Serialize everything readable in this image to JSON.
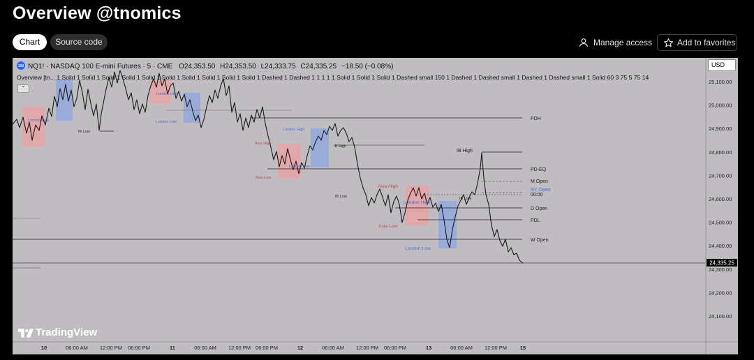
{
  "header": {
    "title": "Overview @tnomics"
  },
  "tabs": [
    {
      "label": "Chart",
      "active": true
    },
    {
      "label": "Source code",
      "active": false
    }
  ],
  "actions": {
    "manage_access": "Manage access",
    "add_favorites": "Add to favorites"
  },
  "chart": {
    "symbol_badge": "100",
    "symbol_line": "NQ1! · NASDAQ 100 E-mini Futures · 5 · CME",
    "ohlc": {
      "open": "O24,353.50",
      "high": "H24,353.50",
      "low": "L24,333.75",
      "close": "C24,335.25",
      "change": "−18.50 (−0.08%)"
    },
    "indicator_line": "Overview [tn... 1 Solid 1 Solid 1 Solid 1 Solid 1 Solid 1 Solid 1 Solid 1 Solid 1 Solid 1 Solid 1 Dashed 1 Dashed 1 1 1 1 1 Solid 1 Solid 1 Solid 1 Dashed small 150 1 Dashed 1 Dashed small 1 Dashed 1 Dashed small 1 Solid 60 3 75 5 75 14",
    "currency": "USD",
    "last_price": "24,335.25",
    "brand": "TradingView",
    "price_ticks": [
      "25,100.00",
      "25,000.00",
      "24,900.00",
      "24,800.00",
      "24,700.00",
      "24,600.00",
      "24,500.00",
      "24,400.00",
      "24,300.00",
      "24,200.00",
      "24,100.00"
    ],
    "time_ticks": [
      {
        "label": "10",
        "bold": true
      },
      {
        "label": "06:00 AM",
        "bold": false
      },
      {
        "label": "12:00 PM",
        "bold": false
      },
      {
        "label": "06:00 PM",
        "bold": false
      },
      {
        "label": "11",
        "bold": true
      },
      {
        "label": "06:00 AM",
        "bold": false
      },
      {
        "label": "12:00 PM",
        "bold": false
      },
      {
        "label": "06:00 PM",
        "bold": false
      },
      {
        "label": "12",
        "bold": true
      },
      {
        "label": "06:00 AM",
        "bold": false
      },
      {
        "label": "12:00 PM",
        "bold": false
      },
      {
        "label": "06:00 PM",
        "bold": false
      },
      {
        "label": "13",
        "bold": true
      },
      {
        "label": "06:00 AM",
        "bold": false
      },
      {
        "label": "12:00 PM",
        "bold": false
      },
      {
        "label": "15",
        "bold": true
      }
    ],
    "level_labels": [
      {
        "text": "PDH",
        "color": "#222222"
      },
      {
        "text": "PD-EQ",
        "color": "#222222"
      },
      {
        "text": "M Open",
        "color": "#222222"
      },
      {
        "text": "NY Open",
        "color": "#4a6fd6"
      },
      {
        "text": "00:00",
        "color": "#222222"
      },
      {
        "text": "D Open",
        "color": "#222222"
      },
      {
        "text": "PDL",
        "color": "#222222"
      },
      {
        "text": "W Open",
        "color": "#222222"
      }
    ],
    "session_labels": [
      {
        "text": "London Low",
        "color": "#4a6fd6"
      },
      {
        "text": "London High",
        "color": "#4a6fd6"
      },
      {
        "text": "London Low",
        "color": "#4a6fd6"
      },
      {
        "text": "London High",
        "color": "#4a6fd6"
      },
      {
        "text": "London Low",
        "color": "#4a6fd6"
      },
      {
        "text": "London High",
        "color": "#4a6fd6"
      },
      {
        "text": "London Low",
        "color": "#4a6fd6"
      },
      {
        "text": "Asia High",
        "color": "#c0464f"
      },
      {
        "text": "Asia Low",
        "color": "#c0464f"
      },
      {
        "text": "Asia High",
        "color": "#c0464f"
      },
      {
        "text": "Asia Low",
        "color": "#c0464f"
      },
      {
        "text": "IB Low",
        "color": "#222222"
      },
      {
        "text": "IB High",
        "color": "#222222"
      },
      {
        "text": "IB Low",
        "color": "#222222"
      },
      {
        "text": "IB High",
        "color": "#222222"
      },
      {
        "text": "IB Low",
        "color": "#222222"
      }
    ],
    "colors": {
      "background": "#c0bdc1",
      "candles": "#1a1a1a",
      "london_box": "#8fa7de",
      "asia_box": "#e7a3a3",
      "level_line": "#222222",
      "price_badge_bg": "#000000"
    }
  }
}
